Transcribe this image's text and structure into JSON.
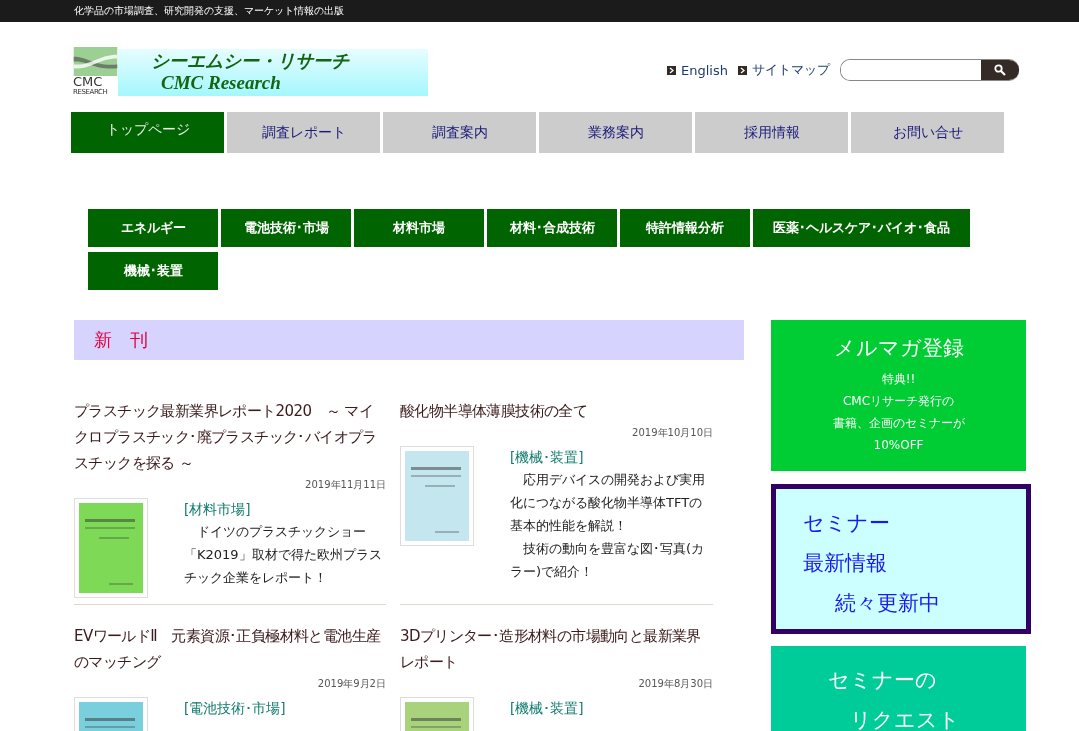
{
  "top_bar": {
    "text": "化学品の市場調査、研究開発の支援、マーケット情報の出版"
  },
  "logo": {
    "mark_text": "CMC",
    "mark_sub": "RESEARCH",
    "title": "シーエムシー・リサーチ",
    "subtitle": "CMC Research"
  },
  "header_links": [
    "English",
    "サイトマップ"
  ],
  "nav_tabs": [
    {
      "label": "トップページ",
      "selected": true
    },
    {
      "label": "調査レポート",
      "selected": false
    },
    {
      "label": "調査案内",
      "selected": false
    },
    {
      "label": "業務案内",
      "selected": false
    },
    {
      "label": "採用情報",
      "selected": false
    },
    {
      "label": "お問い合せ",
      "selected": false
    }
  ],
  "categories": [
    [
      "エネルギー",
      "電池技術･市場",
      "材料市場",
      "材料･合成技術",
      "特許情報分析",
      "医薬･ヘルスケア･バイオ･食品"
    ],
    [
      "機械･装置"
    ]
  ],
  "section_title": "新　刊",
  "articles": [
    {
      "title": "プラスチック最新業界レポート2020　～ マイクロプラスチック･廃プラスチック･バイオプラスチックを探る ～",
      "date": "2019年11月11日",
      "category": "[材料市場]",
      "paragraphs": [
        "　ドイツのプラスチックショー「K2019」取材で得た欧州プラスチック企業をレポート！"
      ]
    },
    {
      "title": "酸化物半導体薄膜技術の全て",
      "date": "2019年10月10日",
      "category": "[機械･装置]",
      "paragraphs": [
        "　応用デバイスの開発および実用化につながる酸化物半導体TFTの基本的性能を解説！",
        "　技術の動向を豊富な図･写真(カラー)で紹介！"
      ]
    },
    {
      "title": "EVワールドⅡ　元素資源･正負極材料と電池生産のマッチング",
      "date": "2019年9月2日",
      "category": "[電池技術･市場]"
    },
    {
      "title": "3Dプリンター･造形材料の市場動向と最新業界レポート",
      "date": "2019年8月30日",
      "category": "[機械･装置]"
    }
  ],
  "sidebar": {
    "newsletter": {
      "title": "メルマガ登録",
      "lines": [
        "特典!!",
        "CMCリサーチ発行の",
        "書籍、企画のセミナーが",
        "10%OFF"
      ]
    },
    "seminar": {
      "lines": [
        "セミナー",
        "最新情報",
        "続々更新中"
      ]
    },
    "request": {
      "lines": [
        "セミナーの",
        "リクエスト"
      ]
    }
  }
}
